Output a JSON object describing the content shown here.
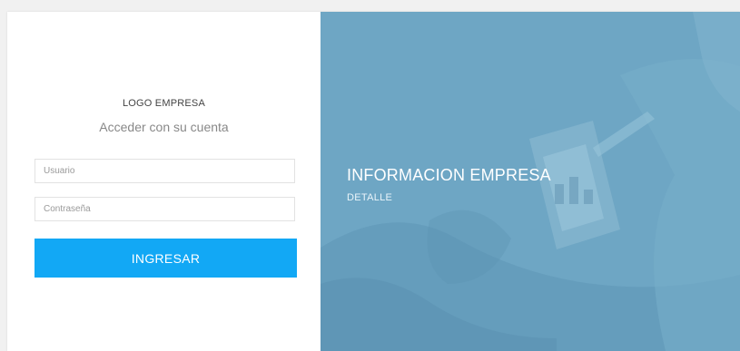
{
  "login": {
    "brand": "LOGO EMPRESA",
    "subtitle": "Acceder con su cuenta",
    "username_placeholder": "Usuario",
    "username_value": "",
    "password_placeholder": "Contraseña",
    "password_value": "",
    "submit_label": "INGRESAR"
  },
  "info": {
    "title": "INFORMACION EMPRESA",
    "detail": "DETALLE"
  },
  "colors": {
    "accent": "#12a8f5",
    "info_overlay": "#6aa4c3",
    "panel_bg": "#ffffff"
  }
}
